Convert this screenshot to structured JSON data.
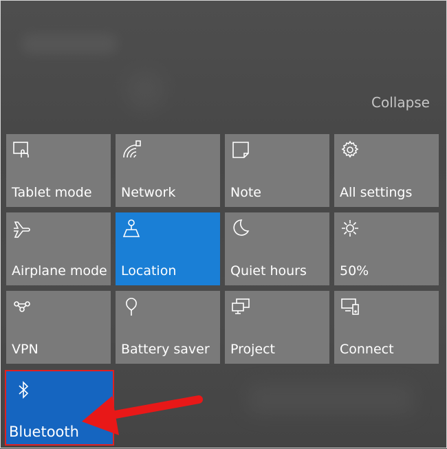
{
  "header": {
    "collapse_label": "Collapse"
  },
  "tiles": [
    {
      "label": "Tablet mode",
      "icon": "tablet-mode-icon",
      "active": false
    },
    {
      "label": "Network",
      "icon": "network-icon",
      "active": false
    },
    {
      "label": "Note",
      "icon": "note-icon",
      "active": false
    },
    {
      "label": "All settings",
      "icon": "gear-icon",
      "active": false
    },
    {
      "label": "Airplane mode",
      "icon": "airplane-icon",
      "active": false
    },
    {
      "label": "Location",
      "icon": "location-icon",
      "active": true
    },
    {
      "label": "Quiet hours",
      "icon": "moon-icon",
      "active": false
    },
    {
      "label": "50%",
      "icon": "brightness-icon",
      "active": false
    },
    {
      "label": "VPN",
      "icon": "vpn-icon",
      "active": false
    },
    {
      "label": "Battery saver",
      "icon": "battery-saver-icon",
      "active": false
    },
    {
      "label": "Project",
      "icon": "project-icon",
      "active": false
    },
    {
      "label": "Connect",
      "icon": "connect-icon",
      "active": false
    }
  ],
  "bluetooth": {
    "label": "Bluetooth",
    "icon": "bluetooth-icon",
    "active": true
  },
  "colors": {
    "tile": "#7a7a7a",
    "active": "#1a7fd6",
    "highlight": "#e02020"
  }
}
